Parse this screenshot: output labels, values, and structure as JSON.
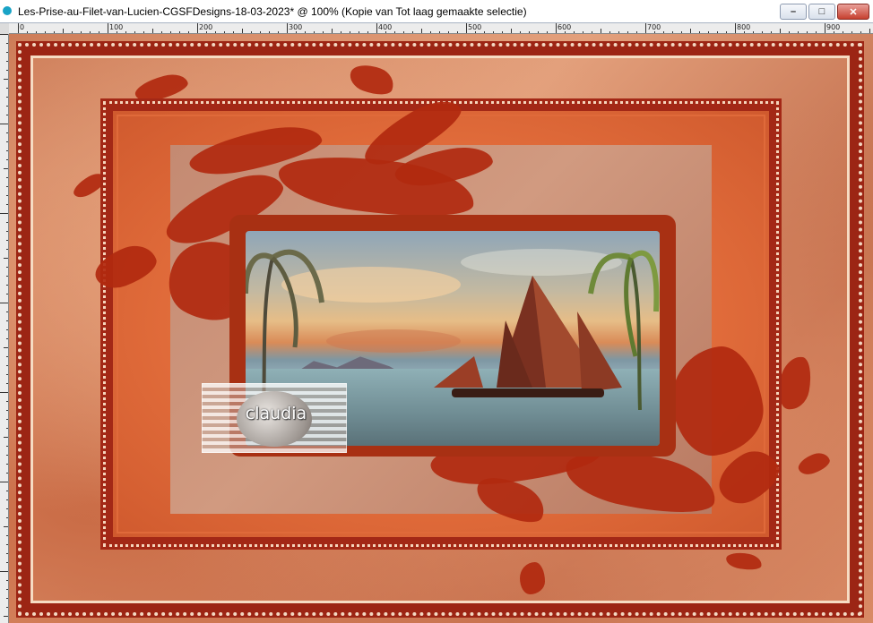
{
  "window": {
    "title": "Les-Prise-au-Filet-van-Lucien-CGSFDesigns-18-03-2023* @ 100% (Kopie van Tot laag gemaakte selectie)",
    "buttons": {
      "minimize": "–",
      "maximize": "□",
      "close": "✕"
    }
  },
  "ruler": {
    "h_labels": [
      "0",
      "100",
      "200",
      "300",
      "400",
      "500",
      "600",
      "700",
      "800",
      "900"
    ]
  },
  "watermark": {
    "text": "claudia"
  },
  "colors": {
    "frame": "#9c2514",
    "accent": "#e06b3a",
    "sky": "#e6bd87",
    "water": "#6f8c93"
  },
  "icons": {
    "app": "paintshop-icon",
    "minimize": "minimize-icon",
    "maximize": "maximize-icon",
    "close": "close-icon"
  }
}
